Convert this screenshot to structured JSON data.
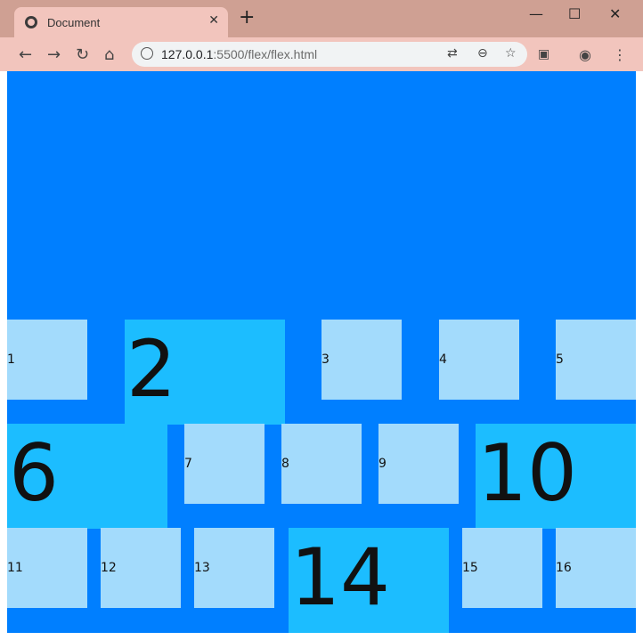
{
  "browser": {
    "tab_title": "Document",
    "tab_close": "✕",
    "new_tab": "+",
    "url_host": "127.0.0.1",
    "url_path": ":5500/flex/flex.html",
    "minimize": "—",
    "maximize": "☐",
    "close": "✕"
  },
  "icons": {
    "back": "back-arrow-icon",
    "forward": "forward-arrow-icon",
    "reload": "reload-icon",
    "home": "home-icon",
    "translate": "translate-icon",
    "zoom": "zoom-out-icon",
    "bookmark": "star-icon",
    "extension": "extension-icon",
    "profile": "avatar",
    "menu": "kebab-menu-icon"
  },
  "colors": {
    "container": "#007fff",
    "small_box": "#a3dbfc",
    "big_box": "#1cbdff"
  },
  "boxes": [
    {
      "label": "1",
      "big": false
    },
    {
      "label": "2",
      "big": true
    },
    {
      "label": "3",
      "big": false
    },
    {
      "label": "4",
      "big": false
    },
    {
      "label": "5",
      "big": false
    },
    {
      "label": "6",
      "big": true
    },
    {
      "label": "7",
      "big": false
    },
    {
      "label": "8",
      "big": false
    },
    {
      "label": "9",
      "big": false
    },
    {
      "label": "10",
      "big": true
    },
    {
      "label": "11",
      "big": false
    },
    {
      "label": "12",
      "big": false
    },
    {
      "label": "13",
      "big": false
    },
    {
      "label": "14",
      "big": true
    },
    {
      "label": "15",
      "big": false
    },
    {
      "label": "16",
      "big": false
    }
  ]
}
